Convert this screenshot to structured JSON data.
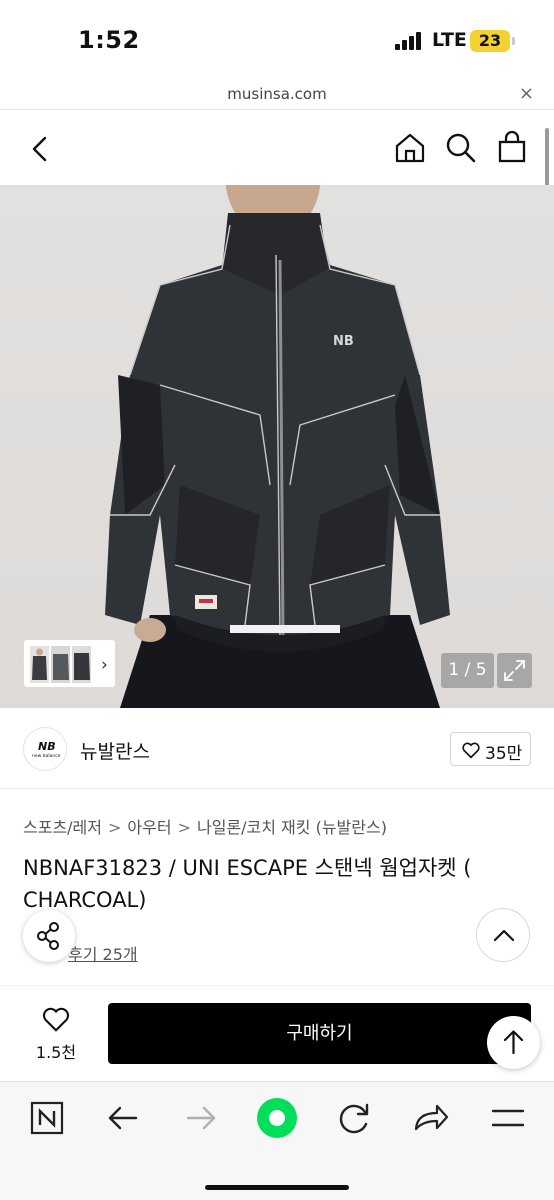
{
  "status_bar": {
    "time": "1:52",
    "network": "LTE",
    "battery": "23"
  },
  "browser": {
    "url": "musinsa.com",
    "close_glyph": "×"
  },
  "gallery": {
    "counter": "1 / 5",
    "thumb_arrow": "›"
  },
  "brand": {
    "name": "뉴발란스",
    "likes": "35만"
  },
  "breadcrumb": [
    "스포츠/레저",
    "아우터",
    "나일론/코치 재킷 (뉴발란스)"
  ],
  "breadcrumb_sep": ">",
  "product": {
    "title_line1": "NBNAF31823 / UNI ESCAPE 스탠넥 웜업자켓 (",
    "title_line2": "CHARCOAL)",
    "reviews": "후기 25개"
  },
  "purchase": {
    "wish_count": "1.5천",
    "buy_label": "구매하기"
  },
  "colors": {
    "accent": "#00de5a",
    "buy_button": "#000000",
    "battery": "#f2d230"
  },
  "icons": [
    "back-icon",
    "home-icon",
    "search-icon",
    "cart-icon",
    "heart-icon",
    "share-icon",
    "chevron-up-icon",
    "arrow-up-icon",
    "n-icon",
    "back-arrow-icon",
    "forward-arrow-icon",
    "green-dot-icon",
    "reload-icon",
    "share-arrow-icon",
    "menu-icon"
  ]
}
